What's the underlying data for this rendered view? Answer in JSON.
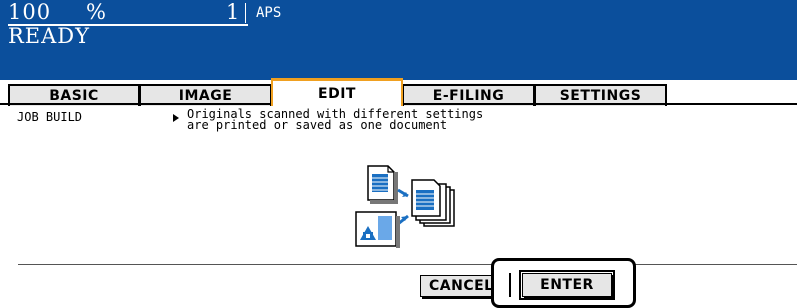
{
  "header": {
    "zoom_value": "100",
    "zoom_unit": "%",
    "copies": "1",
    "paper": "APS",
    "status": "READY"
  },
  "tabs": [
    {
      "label": "BASIC",
      "active": false
    },
    {
      "label": "IMAGE",
      "active": false
    },
    {
      "label": "EDIT",
      "active": true
    },
    {
      "label": "E-FILING",
      "active": false
    },
    {
      "label": "SETTINGS",
      "active": false
    }
  ],
  "content": {
    "feature_title": "JOB BUILD",
    "description_line1": "Originals scanned with different settings",
    "description_line2": "are printed or saved as one document",
    "illustration_icon": "job-build-illustration"
  },
  "buttons": {
    "cancel_label": "CANCEL",
    "enter_label": "ENTER"
  },
  "colors": {
    "header_bg": "#0b4f9c",
    "active_tab_accent": "#f0a020",
    "icon_blue": "#1a6fc2"
  }
}
